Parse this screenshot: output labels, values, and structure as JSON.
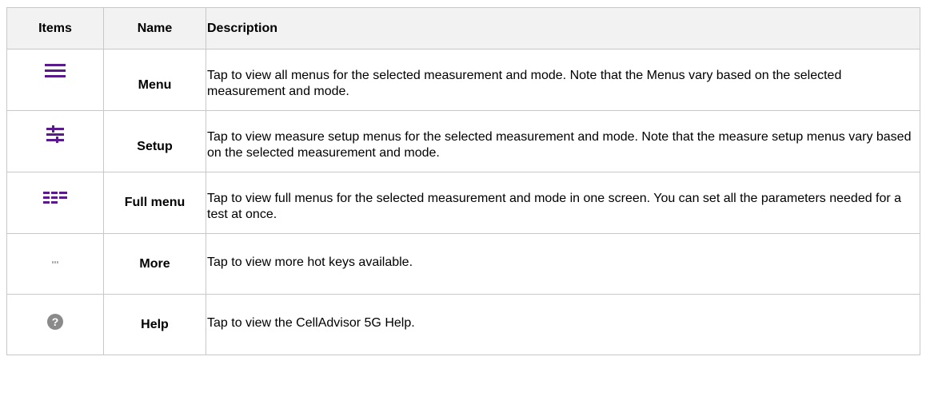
{
  "headers": {
    "items": "Items",
    "name": "Name",
    "description": "Description"
  },
  "colors": {
    "accent": "#5b1a8b",
    "help_icon": "#8a8a8a",
    "more_icon": "#b0b0b0"
  },
  "rows": [
    {
      "icon": "hamburger-menu-icon",
      "name": "Menu",
      "description": "Tap to view all menus for the selected measurement and mode. Note that the Menus vary based on the selected measurement and mode."
    },
    {
      "icon": "setup-sliders-icon",
      "name": "Setup",
      "description": "Tap to view measure setup menus for the selected measurement and mode. Note that the measure setup menus vary based on the selected measurement and mode."
    },
    {
      "icon": "full-menu-icon",
      "name": "Full menu",
      "description": "Tap to view full menus for the selected measurement and mode in one screen. You can set all the parameters needed for a test at once."
    },
    {
      "icon": "more-dots-icon",
      "name": "More",
      "description": "Tap to view more hot keys available."
    },
    {
      "icon": "help-question-icon",
      "name": "Help",
      "description": "Tap to view the CellAdvisor 5G Help."
    }
  ]
}
